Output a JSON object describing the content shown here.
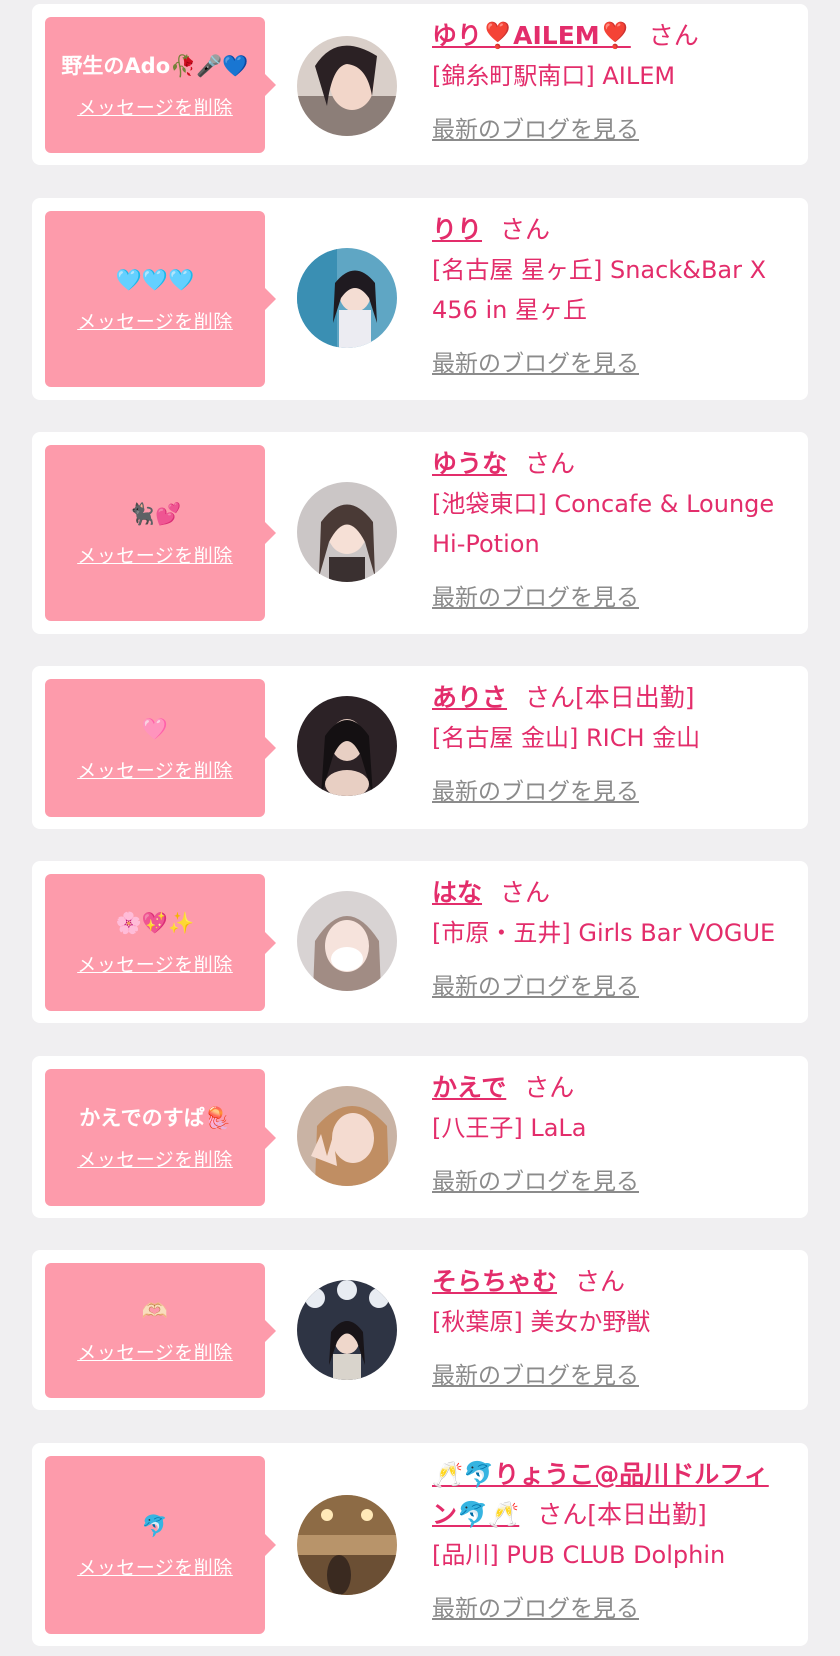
{
  "delete_label": "メッセージを削除",
  "blog_label": "最新のブログを見る",
  "colors": {
    "bubble": "#fd9bab",
    "accent": "#e32d6b",
    "link_gray": "#8b8b8b",
    "background": "#f0eff1"
  },
  "items": [
    {
      "message": "野生のAdo🥀🎤💙",
      "name": "ゆり❣️AILEM❣️",
      "suffix": "さん",
      "shop": "[錦糸町駅南口] AILEM",
      "avatar": "photo of woman with dark hair"
    },
    {
      "message": "🩵🩵🩵",
      "name": "りり",
      "suffix": "さん",
      "shop": "[名古屋 星ヶ丘] Snack&Bar X 456 in 星ヶ丘",
      "avatar": "photo of woman in front of blue background"
    },
    {
      "message": "🐈‍⬛💕",
      "name": "ゆうな",
      "suffix": "さん",
      "shop": "[池袋東口] Concafe & Lounge Hi-Potion",
      "avatar": "photo of woman with earphones"
    },
    {
      "message": "🩷",
      "name": "ありさ",
      "suffix": "さん[本日出勤]",
      "shop": "[名古屋 金山] RICH 金山",
      "avatar": "photo of woman in dark outfit"
    },
    {
      "message": "🌸💖✨",
      "name": "はな",
      "suffix": "さん",
      "shop": "[市原・五井] Girls Bar VOGUE",
      "avatar": "photo of woman with mask"
    },
    {
      "message": "かえでのすぱ🪼",
      "name": "かえで",
      "suffix": "さん",
      "shop": "[八王子] LaLa",
      "avatar": "photo of woman making peace sign"
    },
    {
      "message": "🫶🏻",
      "name": "そらちゃむ",
      "suffix": "さん",
      "shop": "[秋葉原] 美女か野獣",
      "avatar": "photo of woman under lights"
    },
    {
      "message": "🐬",
      "name": "🥂🐬りょうこ@品川ドルフィン🐬🥂",
      "suffix": "さん[本日出勤]",
      "shop": "[品川] PUB CLUB Dolphin",
      "avatar": "photo of woman in chandelier-lit room"
    }
  ]
}
